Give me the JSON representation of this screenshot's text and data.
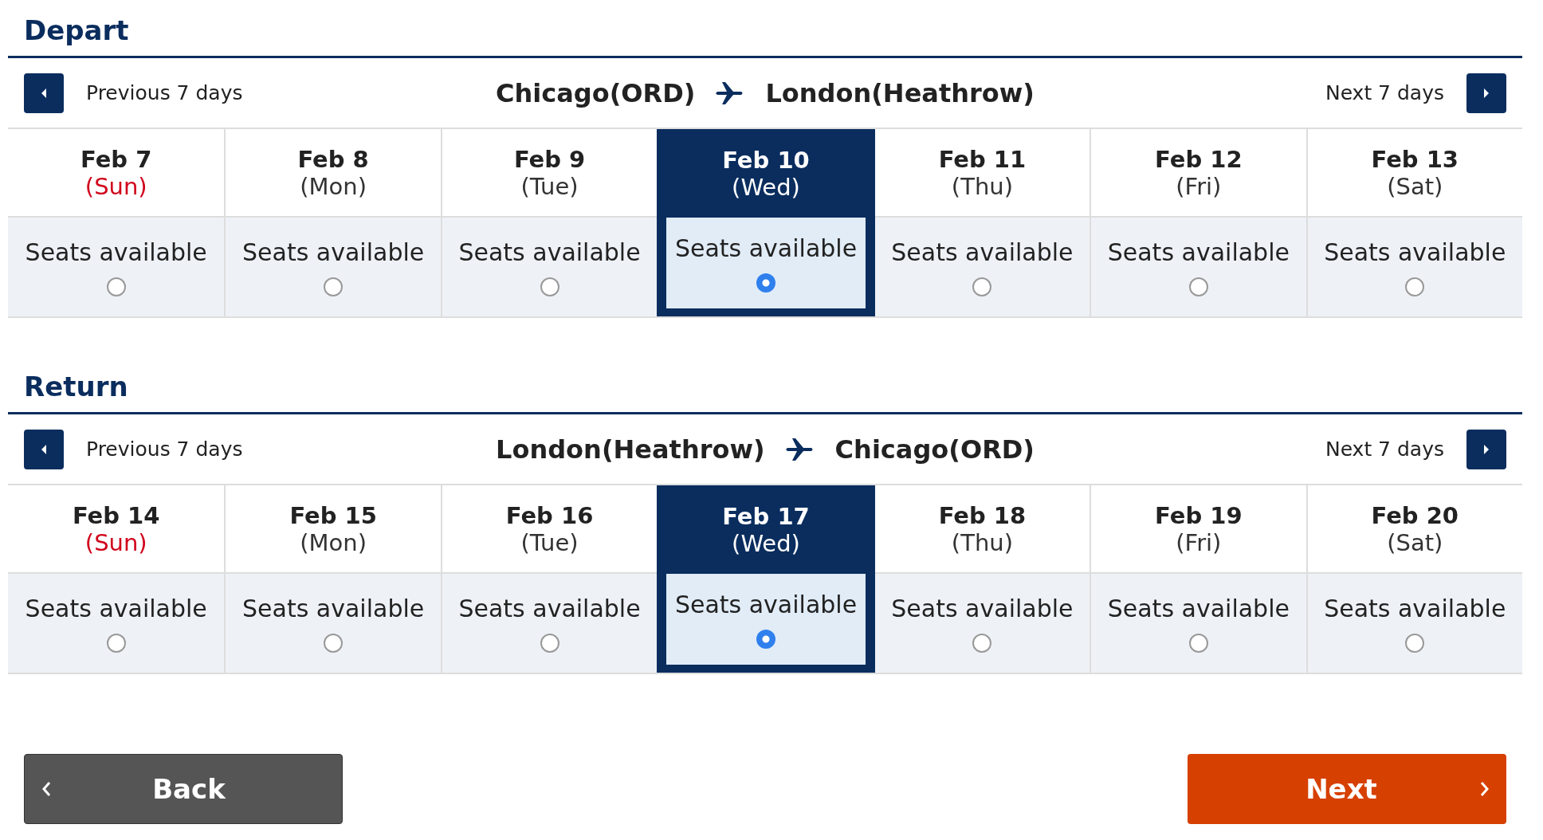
{
  "sections": [
    {
      "title": "Depart",
      "previous": "Previous 7 days",
      "next": "Next 7 days",
      "origin": "Chicago(ORD)",
      "destination": "London(Heathrow)",
      "days": [
        {
          "date": "Feb 7",
          "weekday": "(Sun)",
          "color": "#d0021b",
          "availability": "Seats available",
          "selected": false
        },
        {
          "date": "Feb 8",
          "weekday": "(Mon)",
          "color": "#333333",
          "availability": "Seats available",
          "selected": false
        },
        {
          "date": "Feb 9",
          "weekday": "(Tue)",
          "color": "#333333",
          "availability": "Seats available",
          "selected": false
        },
        {
          "date": "Feb 10",
          "weekday": "(Wed)",
          "color": "#ffffff",
          "availability": "Seats available",
          "selected": true
        },
        {
          "date": "Feb 11",
          "weekday": "(Thu)",
          "color": "#333333",
          "availability": "Seats available",
          "selected": false
        },
        {
          "date": "Feb 12",
          "weekday": "(Fri)",
          "color": "#333333",
          "availability": "Seats available",
          "selected": false
        },
        {
          "date": "Feb 13",
          "weekday": "(Sat)",
          "color": "#333333",
          "availability": "Seats available",
          "selected": false
        }
      ]
    },
    {
      "title": "Return",
      "previous": "Previous 7 days",
      "next": "Next 7 days",
      "origin": "London(Heathrow)",
      "destination": "Chicago(ORD)",
      "days": [
        {
          "date": "Feb 14",
          "weekday": "(Sun)",
          "color": "#d0021b",
          "availability": "Seats available",
          "selected": false
        },
        {
          "date": "Feb 15",
          "weekday": "(Mon)",
          "color": "#333333",
          "availability": "Seats available",
          "selected": false
        },
        {
          "date": "Feb 16",
          "weekday": "(Tue)",
          "color": "#333333",
          "availability": "Seats available",
          "selected": false
        },
        {
          "date": "Feb 17",
          "weekday": "(Wed)",
          "color": "#ffffff",
          "availability": "Seats available",
          "selected": true
        },
        {
          "date": "Feb 18",
          "weekday": "(Thu)",
          "color": "#333333",
          "availability": "Seats available",
          "selected": false
        },
        {
          "date": "Feb 19",
          "weekday": "(Fri)",
          "color": "#333333",
          "availability": "Seats available",
          "selected": false
        },
        {
          "date": "Feb 20",
          "weekday": "(Sat)",
          "color": "#333333",
          "availability": "Seats available",
          "selected": false
        }
      ]
    }
  ],
  "buttons": {
    "back": "Back",
    "next": "Next"
  }
}
